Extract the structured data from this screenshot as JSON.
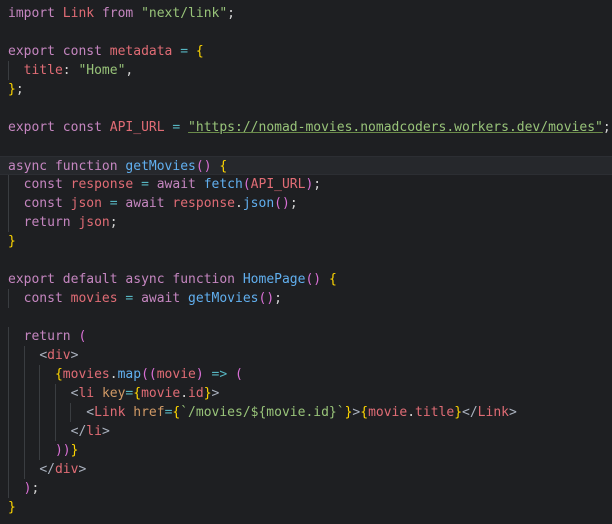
{
  "editor": {
    "language": "javascript-jsx",
    "lines": [
      "import Link from \"next/link\";",
      "",
      "export const metadata = {",
      "  title: \"Home\",",
      "};",
      "",
      "export const API_URL = \"https://nomad-movies.nomadcoders.workers.dev/movies\";",
      "",
      "async function getMovies() {",
      "  const response = await fetch(API_URL);",
      "  const json = await response.json();",
      "  return json;",
      "}",
      "",
      "export default async function HomePage() {",
      "  const movies = await getMovies();",
      "",
      "  return (",
      "    <div>",
      "      {movies.map((movie) => (",
      "        <li key={movie.id}>",
      "          <Link href={`/movies/${movie.id}`}>{movie.title}</Link>",
      "        </li>",
      "      ))}",
      "    </div>",
      "  );",
      "}"
    ],
    "active_line": 9,
    "theme_colors": {
      "background": "#1e1f22",
      "keyword": "#c586c0",
      "function": "#61afef",
      "string": "#98c379",
      "tag": "#e06c75"
    }
  }
}
